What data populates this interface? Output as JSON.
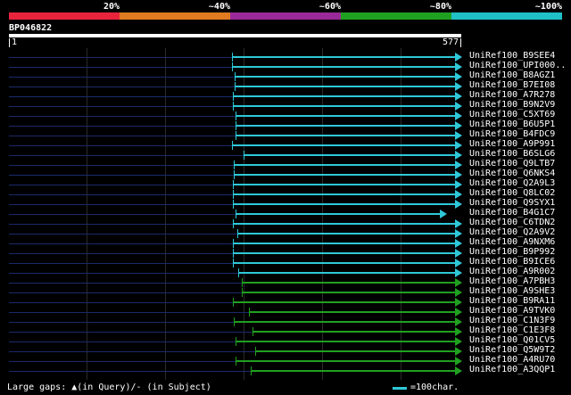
{
  "legend": {
    "labels": [
      "20%",
      "~40%",
      "~60%",
      "~80%",
      "~100%"
    ],
    "colors": [
      "#e8243c",
      "#e07a20",
      "#9a2a9a",
      "#20a020",
      "#20c0c8"
    ]
  },
  "query": {
    "name": "BP046822",
    "start_label": "1",
    "end_label": "577"
  },
  "hits": [
    {
      "label": "UniRef100_B9SEE4",
      "start": 285,
      "end": 577,
      "color": "#2ec8d8"
    },
    {
      "label": "UniRef100_UPI000..",
      "start": 285,
      "end": 577,
      "color": "#2ec8d8"
    },
    {
      "label": "UniRef100_B8AGZ1",
      "start": 288,
      "end": 577,
      "color": "#2ec8d8"
    },
    {
      "label": "UniRef100_B7EI08",
      "start": 288,
      "end": 577,
      "color": "#2ec8d8"
    },
    {
      "label": "UniRef100_A7R278",
      "start": 286,
      "end": 577,
      "color": "#2ec8d8"
    },
    {
      "label": "UniRef100_B9N2V9",
      "start": 286,
      "end": 577,
      "color": "#2ec8d8"
    },
    {
      "label": "UniRef100_C5XT69",
      "start": 290,
      "end": 577,
      "color": "#2ec8d8"
    },
    {
      "label": "UniRef100_B6U5P1",
      "start": 290,
      "end": 577,
      "color": "#2ec8d8"
    },
    {
      "label": "UniRef100_B4FDC9",
      "start": 290,
      "end": 577,
      "color": "#2ec8d8"
    },
    {
      "label": "UniRef100_A9P991",
      "start": 285,
      "end": 577,
      "color": "#2ec8d8"
    },
    {
      "label": "UniRef100_B6SLG6",
      "start": 300,
      "end": 577,
      "color": "#2ec8d8"
    },
    {
      "label": "UniRef100_Q9LTB7",
      "start": 287,
      "end": 577,
      "color": "#2ec8d8"
    },
    {
      "label": "UniRef100_Q6NKS4",
      "start": 287,
      "end": 577,
      "color": "#2ec8d8"
    },
    {
      "label": "UniRef100_Q2A9L3",
      "start": 286,
      "end": 577,
      "color": "#2ec8d8"
    },
    {
      "label": "UniRef100_Q8LC02",
      "start": 286,
      "end": 577,
      "color": "#2ec8d8"
    },
    {
      "label": "UniRef100_Q9SYX1",
      "start": 286,
      "end": 577,
      "color": "#2ec8d8"
    },
    {
      "label": "UniRef100_B4G1C7",
      "start": 290,
      "end": 558,
      "color": "#2ec8d8"
    },
    {
      "label": "UniRef100_C6TDN2",
      "start": 286,
      "end": 577,
      "color": "#2ec8d8"
    },
    {
      "label": "UniRef100_Q2A9V2",
      "start": 292,
      "end": 577,
      "color": "#2ec8d8"
    },
    {
      "label": "UniRef100_A9NXM6",
      "start": 286,
      "end": 577,
      "color": "#2ec8d8"
    },
    {
      "label": "UniRef100_B9P992",
      "start": 286,
      "end": 577,
      "color": "#2ec8d8"
    },
    {
      "label": "UniRef100_B9ICE6",
      "start": 286,
      "end": 577,
      "color": "#2ec8d8"
    },
    {
      "label": "UniRef100_A9R002",
      "start": 293,
      "end": 577,
      "color": "#2ec8d8"
    },
    {
      "label": "UniRef100_A7PBH3",
      "start": 298,
      "end": 577,
      "color": "#20a020"
    },
    {
      "label": "UniRef100_A9SHE3",
      "start": 297,
      "end": 577,
      "color": "#20a020"
    },
    {
      "label": "UniRef100_B9RA11",
      "start": 286,
      "end": 577,
      "color": "#20a020"
    },
    {
      "label": "UniRef100_A9TVK0",
      "start": 307,
      "end": 577,
      "color": "#20a020"
    },
    {
      "label": "UniRef100_C1N3F9",
      "start": 287,
      "end": 577,
      "color": "#20a020"
    },
    {
      "label": "UniRef100_C1E3F8",
      "start": 311,
      "end": 577,
      "color": "#20a020"
    },
    {
      "label": "UniRef100_Q01CV5",
      "start": 290,
      "end": 577,
      "color": "#20a020"
    },
    {
      "label": "UniRef100_Q5W9T2",
      "start": 314,
      "end": 577,
      "color": "#20a020"
    },
    {
      "label": "UniRef100_A4RU70",
      "start": 290,
      "end": 577,
      "color": "#20a020"
    },
    {
      "label": "UniRef100_A3QQP1",
      "start": 309,
      "end": 577,
      "color": "#20a020"
    }
  ],
  "footer": {
    "gaps_text": "Large gaps: ▲(in Query)/- (in Subject)",
    "scale_text": "=100char."
  }
}
